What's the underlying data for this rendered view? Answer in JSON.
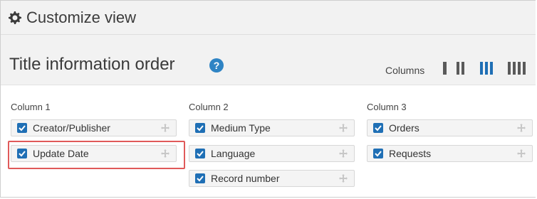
{
  "header": {
    "title": "Customize view",
    "icon": "gear-icon"
  },
  "section": {
    "title": "Title information order",
    "help_icon": "?",
    "columns_label": "Columns",
    "column_options": [
      1,
      2,
      3,
      4
    ],
    "selected_columns": 3
  },
  "columns": [
    {
      "title": "Column 1",
      "items": [
        "Creator/Publisher",
        "Update Date"
      ]
    },
    {
      "title": "Column 2",
      "items": [
        "Medium Type",
        "Language",
        "Record number"
      ]
    },
    {
      "title": "Column 3",
      "items": [
        "Orders",
        "Requests"
      ]
    }
  ],
  "colors": {
    "accent": "#1f6fb5",
    "highlight": "#e05a5a"
  }
}
